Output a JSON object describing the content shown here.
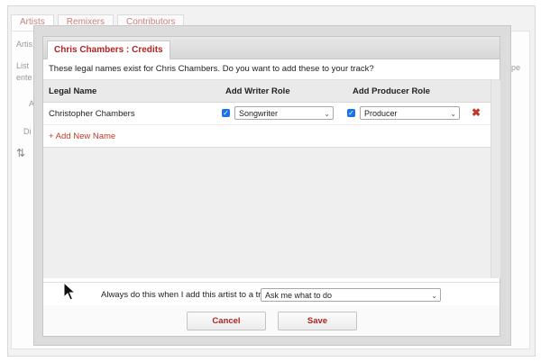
{
  "background": {
    "tabs": [
      "Artists",
      "Remixers",
      "Contributors"
    ],
    "fragments": {
      "a": "Artis",
      "b": "List",
      "c": "ente",
      "d": "A",
      "e": "Di",
      "f": "pe"
    }
  },
  "dialog": {
    "title": "Chris Chambers : Credits",
    "intro": "These legal names exist for Chris Chambers. Do you want to add these to your track?",
    "columns": {
      "legal_name": "Legal Name",
      "writer_role": "Add Writer Role",
      "producer_role": "Add Producer Role"
    },
    "rows": [
      {
        "legal_name": "Christopher Chambers",
        "writer_checked": true,
        "writer_role": "Songwriter",
        "producer_checked": true,
        "producer_role": "Producer"
      }
    ],
    "add_new_name": "+ Add New Name",
    "always_label": "Always do this when I add this artist to a track :",
    "always_value": "Ask me what to do",
    "cancel_label": "Cancel",
    "save_label": "Save"
  },
  "icons": {
    "checkbox": "checkmark-icon",
    "remove": "remove-x-icon",
    "sort": "sort-arrows-icon",
    "dropdown": "chevron-down-icon",
    "cursor": "mouse-pointer-icon"
  },
  "colors": {
    "accent": "#b22222",
    "checkbox": "#1a73e8"
  }
}
